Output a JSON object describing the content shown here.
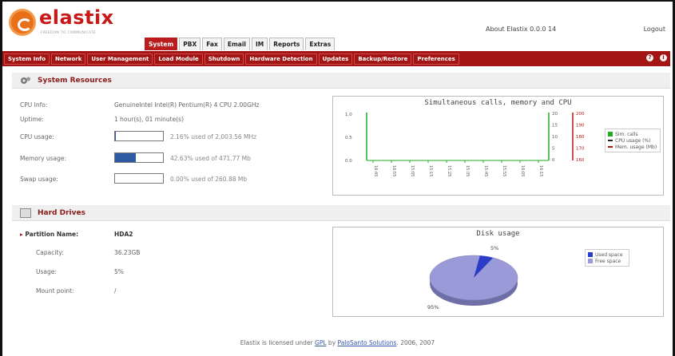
{
  "app": {
    "logo_text": "elastix",
    "logo_subtitle": "FREEDOM TO COMMUNICATE",
    "about": "About Elastix 0.0.0 14",
    "logout": "Logout"
  },
  "top_tabs": [
    {
      "label": "System",
      "active": true
    },
    {
      "label": "PBX",
      "active": false
    },
    {
      "label": "Fax",
      "active": false
    },
    {
      "label": "Email",
      "active": false
    },
    {
      "label": "IM",
      "active": false
    },
    {
      "label": "Reports",
      "active": false
    },
    {
      "label": "Extras",
      "active": false
    }
  ],
  "sub_nav": [
    {
      "label": "System Info",
      "active": true
    },
    {
      "label": "Network",
      "active": false
    },
    {
      "label": "User Management",
      "active": false
    },
    {
      "label": "Load Module",
      "active": false
    },
    {
      "label": "Shutdown",
      "active": false
    },
    {
      "label": "Hardware Detection",
      "active": false
    },
    {
      "label": "Updates",
      "active": false
    },
    {
      "label": "Backup/Restore",
      "active": false
    },
    {
      "label": "Preferences",
      "active": false
    }
  ],
  "system_resources": {
    "title": "System Resources",
    "cpu_info_label": "CPU Info:",
    "cpu_info_value": "GenuineIntel Intel(R) Pentium(R) 4 CPU 2.00GHz",
    "uptime_label": "Uptime:",
    "uptime_value": "1 hour(s), 01 minute(s)",
    "cpu_usage_label": "CPU usage:",
    "cpu_usage_text": "2.16% used of 2,003.56 MHz",
    "cpu_usage_percent": 2.16,
    "memory_label": "Memory usage:",
    "memory_text": "42.63% used of 471.77 Mb",
    "memory_percent": 42.63,
    "swap_label": "Swap usage:",
    "swap_text": "0.00% used of 260.88 Mb",
    "swap_percent": 0.0
  },
  "line_chart": {
    "title": "Simultaneous calls, memory and CPU",
    "y_left_ticks": [
      "1.0",
      "0.5",
      "0.0"
    ],
    "y_mid_ticks": [
      "20",
      "15",
      "10",
      "5",
      "0"
    ],
    "y_right_ticks": [
      "200",
      "190",
      "180",
      "170",
      "160"
    ],
    "x_ticks": [
      "16:45",
      "16:55",
      "15:05",
      "15:15",
      "15:25",
      "15:35",
      "15:45",
      "15:55",
      "16:05",
      "16:15"
    ],
    "legend": [
      {
        "label": "Sim. calls",
        "color": "#22aa22"
      },
      {
        "label": "CPU usage (%)",
        "color": "#222222"
      },
      {
        "label": "Mem. usage (Mb)",
        "color": "#b01515"
      }
    ]
  },
  "hard_drives": {
    "title": "Hard Drives",
    "partition_label": "Partition Name:",
    "partition_value": "HDA2",
    "capacity_label": "Capacity:",
    "capacity_value": "36.23GB",
    "usage_label": "Usage:",
    "usage_value": "5%",
    "mount_label": "Mount point:",
    "mount_value": "/"
  },
  "pie_chart": {
    "title": "Disk usage",
    "used_label": "5%",
    "free_label": "95%",
    "legend": [
      {
        "label": "Used space",
        "color": "#2a3cc8"
      },
      {
        "label": "Free space",
        "color": "#9a9ad8"
      }
    ],
    "chart_data": {
      "type": "pie",
      "categories": [
        "Used space",
        "Free space"
      ],
      "values": [
        5,
        95
      ],
      "title": "Disk usage"
    }
  },
  "footer": {
    "text_before": "Elastix is licensed under ",
    "gpl": "GPL",
    "by": " by ",
    "company": "PaloSanto Solutions",
    "text_after": ". 2006, 2007"
  }
}
